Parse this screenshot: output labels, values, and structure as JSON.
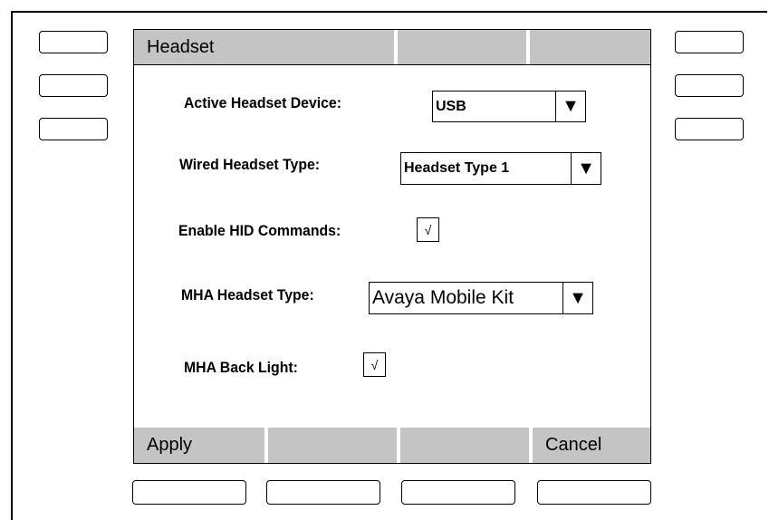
{
  "screen": {
    "title": "Headset",
    "fields": {
      "active_device": {
        "label": "Active Headset Device:",
        "value": "USB",
        "arrow": "▼"
      },
      "wired_type": {
        "label": "Wired Headset Type:",
        "value": "Headset Type 1",
        "arrow": "▼"
      },
      "hid_commands": {
        "label": "Enable HID Commands:",
        "checked": true,
        "mark": "√"
      },
      "mha_type": {
        "label": "MHA Headset Type:",
        "value": "Avaya Mobile Kit",
        "arrow": "▼"
      },
      "mha_backlight": {
        "label": "MHA Back Light:",
        "checked": true,
        "mark": "√"
      }
    },
    "softkeys": [
      "Apply",
      "",
      "",
      "Cancel"
    ]
  }
}
